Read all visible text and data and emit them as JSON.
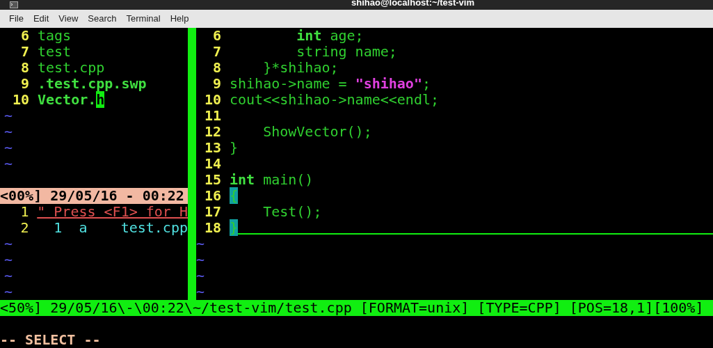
{
  "window": {
    "title": "shihao@localhost:~/test-vim"
  },
  "menu": [
    "File",
    "Edit",
    "View",
    "Search",
    "Terminal",
    "Help"
  ],
  "file_list": {
    "lines": [
      {
        "number": "6",
        "segments": [
          {
            "text": "tags",
            "kind": "plain"
          }
        ]
      },
      {
        "number": "7",
        "segments": [
          {
            "text": "test",
            "kind": "plain"
          }
        ]
      },
      {
        "number": "8",
        "segments": [
          {
            "text": "test.cpp",
            "kind": "plain"
          }
        ]
      },
      {
        "number": "9",
        "segments": [
          {
            "text": ".test.cpp.swp",
            "kind": "bold"
          }
        ]
      },
      {
        "number": "10",
        "segments": [
          {
            "text": "Vector.",
            "kind": "bold"
          },
          {
            "text": "h",
            "kind": "cursor"
          }
        ]
      }
    ],
    "filler": [
      "~",
      "~",
      "~",
      "~"
    ],
    "status": "<00%] 29/05/16 - 00:22"
  },
  "buffer_list": {
    "lines": [
      {
        "number": "1",
        "kind": "comment",
        "text": "\" Press <F1> for H"
      },
      {
        "number": "2",
        "kind": "entry",
        "text": "  1  a    test.cpp"
      }
    ],
    "filler": [
      "~",
      "~",
      "~",
      "~"
    ]
  },
  "code_lines": [
    {
      "number": "6",
      "segments": [
        {
          "text": "        int",
          "kind": "keyword"
        },
        {
          "text": " age;",
          "kind": "plain"
        }
      ]
    },
    {
      "number": "7",
      "segments": [
        {
          "text": "        string name;",
          "kind": "plain"
        }
      ]
    },
    {
      "number": "8",
      "segments": [
        {
          "text": "    }*shihao;",
          "kind": "plain"
        }
      ]
    },
    {
      "number": "9",
      "segments": [
        {
          "text": "shihao->name = ",
          "kind": "plain"
        },
        {
          "text": "\"shihao\"",
          "kind": "string"
        },
        {
          "text": ";",
          "kind": "plain"
        }
      ]
    },
    {
      "number": "10",
      "segments": [
        {
          "text": "cout<<shihao->name<<endl;",
          "kind": "plain"
        }
      ]
    },
    {
      "number": "11"
    },
    {
      "number": "12",
      "segments": [
        {
          "text": "    ShowVector();",
          "kind": "plain"
        }
      ]
    },
    {
      "number": "13",
      "segments": [
        {
          "text": "}",
          "kind": "plain"
        }
      ]
    },
    {
      "number": "14"
    },
    {
      "number": "15",
      "segments": [
        {
          "text": "int",
          "kind": "keyword"
        },
        {
          "text": " main()",
          "kind": "plain"
        }
      ]
    },
    {
      "number": "16",
      "segments": [
        {
          "text": "{",
          "kind": "match"
        }
      ]
    },
    {
      "number": "17",
      "segments": [
        {
          "text": "    Test();",
          "kind": "plain"
        }
      ]
    },
    {
      "number": "18",
      "cursorline": true,
      "segments": [
        {
          "text": "}",
          "kind": "match"
        }
      ]
    }
  ],
  "code_filler": [
    "~",
    "~",
    "~",
    "~"
  ],
  "status_line": "<50%] 29/05/16\\-\\00:22\\~/test-vim/test.cpp [FORMAT=unix] [TYPE=CPP] [POS=18,1][100%]",
  "command_line": "-- SELECT --"
}
